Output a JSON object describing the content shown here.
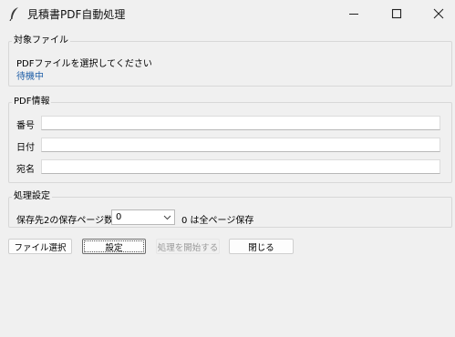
{
  "window": {
    "title": "見積書PDF自動処理",
    "controls": {
      "minimize": "—",
      "maximize": "☐",
      "close": "✕"
    }
  },
  "target_file": {
    "legend": "対象ファイル",
    "prompt": "PDFファイルを選択してください",
    "status": "待機中",
    "status_color": "#1f5fa8"
  },
  "pdf_info": {
    "legend": "PDF情報",
    "fields": [
      {
        "label": "番号",
        "value": ""
      },
      {
        "label": "日付",
        "value": ""
      },
      {
        "label": "宛名",
        "value": ""
      }
    ]
  },
  "settings": {
    "legend": "処理設定",
    "pages_label": "保存先2の保存ページ数",
    "pages_value": "0",
    "pages_hint": "0 は全ページ保存"
  },
  "buttons": {
    "select_file": "ファイル選択",
    "settings": "設定",
    "start": "処理を開始する",
    "close": "閉じる"
  }
}
